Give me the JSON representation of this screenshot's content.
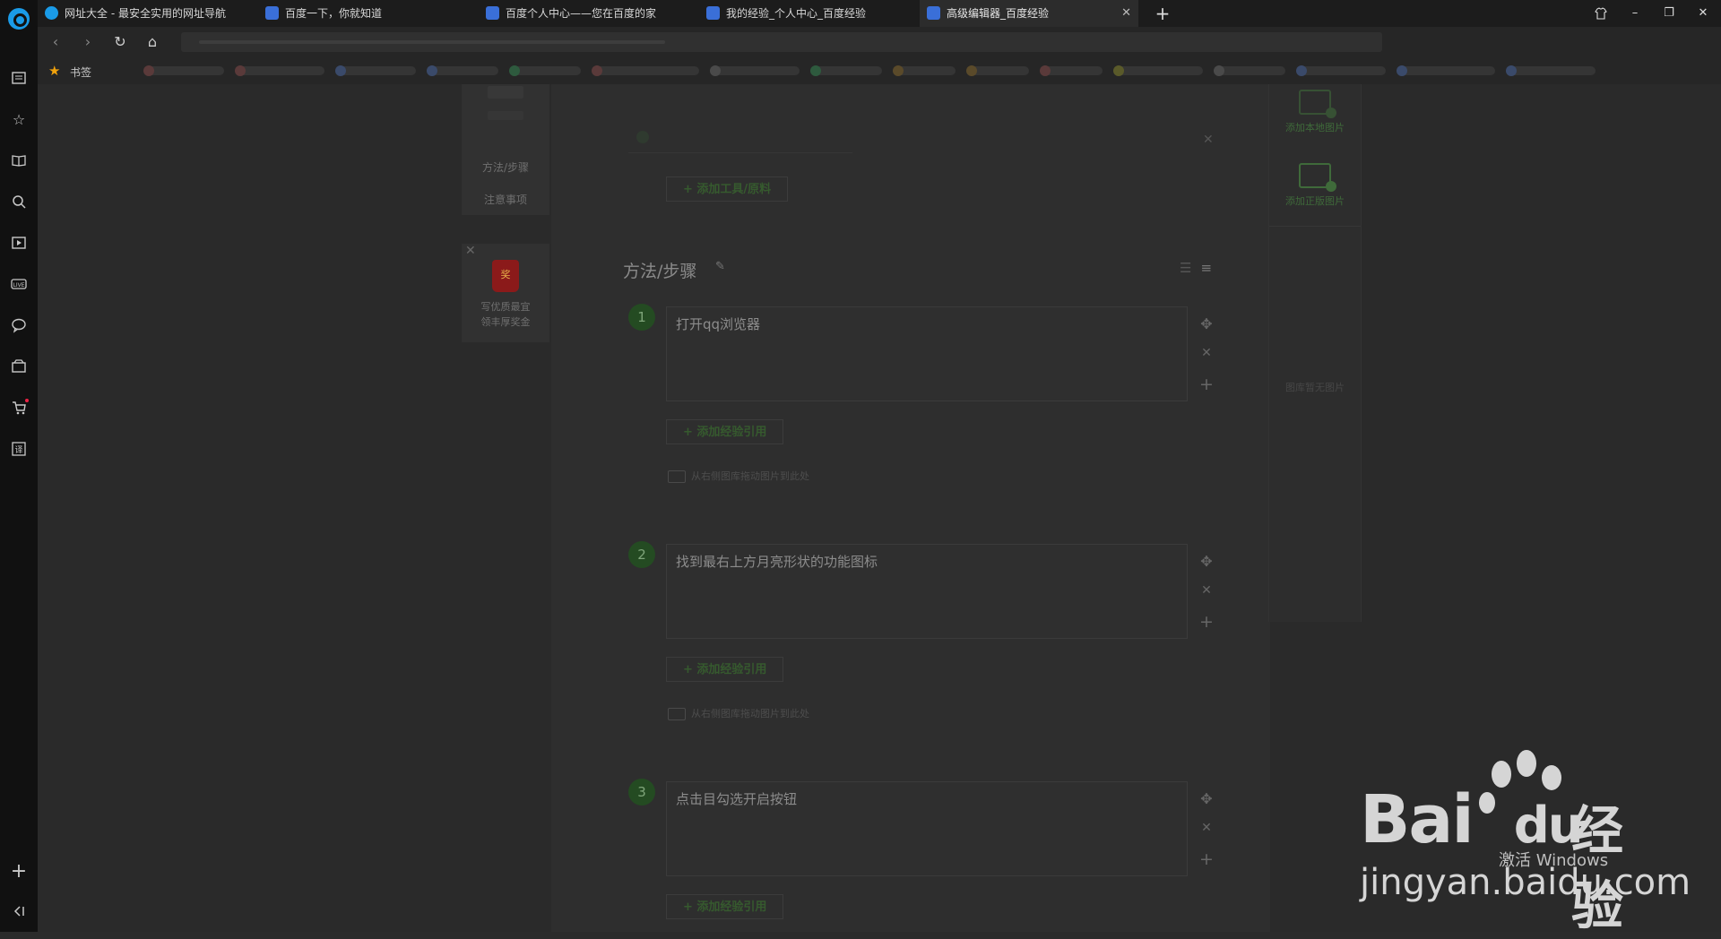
{
  "tabs": [
    {
      "label": "网址大全 - 最安全实用的网址导航"
    },
    {
      "label": "百度一下，你就知道"
    },
    {
      "label": "百度个人中心——您在百度的家"
    },
    {
      "label": "我的经验_个人中心_百度经验"
    },
    {
      "label": "高级编辑器_百度经验",
      "active": true
    }
  ],
  "bookmarks": {
    "label": "书签"
  },
  "outline": {
    "items": [
      "方法/步骤",
      "注意事项"
    ]
  },
  "promo": {
    "badge": "奖",
    "text_line1": "写优质最宜",
    "text_line2": "领丰厚奖金"
  },
  "tools": {
    "add_label": "+ 添加工具/原料"
  },
  "section": {
    "title": "方法/步骤"
  },
  "steps": [
    {
      "number": "1",
      "text": "打开qq浏览器",
      "quote_label": "+ 添加经验引用",
      "hint": "从右侧图库拖动图片到此处"
    },
    {
      "number": "2",
      "text": "找到最右上方月亮形状的功能图标",
      "quote_label": "+ 添加经验引用",
      "hint": "从右侧图库拖动图片到此处"
    },
    {
      "number": "3",
      "text": "点击目勾选开启按钮",
      "quote_label": "+ 添加经验引用"
    }
  ],
  "imgpanel": {
    "add_local": "添加本地图片",
    "add_licensed": "添加正版图片",
    "empty": "图库暂无图片"
  },
  "watermark": {
    "logo": "Bai",
    "logo_du": "du",
    "cn": "经验",
    "url": "jingyan.baidu.com",
    "activate": "激活 Windows"
  },
  "colors": {
    "accent": "#3f6a3a",
    "step_bg": "#244b22"
  }
}
